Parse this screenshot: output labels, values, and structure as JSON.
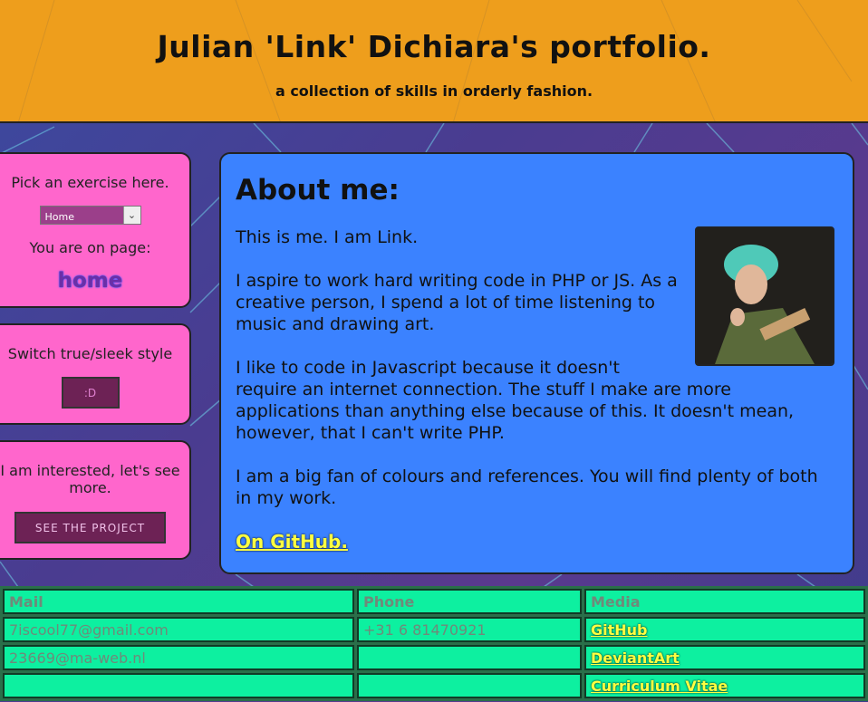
{
  "header": {
    "title": "Julian 'Link' Dichiara's portfolio.",
    "subtitle": "a collection of skills in orderly fashion."
  },
  "sidebar": {
    "exercise_prompt": "Pick an exercise here.",
    "exercise_select_value": "Home",
    "page_label": "You are on page:",
    "page_name": "home",
    "style_prompt": "Switch true/sleek style",
    "style_button_label": ":D",
    "project_prompt": "I am interested, let's see more.",
    "project_button_label": "SEE THE PROJECT"
  },
  "main": {
    "title": "About me:",
    "paragraphs": [
      "This is me. I am Link.",
      "I aspire to work hard writing code in PHP or JS. As a creative person, I spend a lot of time listening to music and drawing art.",
      "I like to code in Javascript because it doesn't require an internet connection. The stuff I make are more applications than anything else because of this. It doesn't mean, however, that I can't write PHP.",
      "I am a big fan of colours and references. You will find plenty of both in my work."
    ],
    "github_link": "On GitHub."
  },
  "contact_table": {
    "headers": [
      "Mail",
      "Phone",
      "Media"
    ],
    "rows": [
      [
        "7iscool77@gmail.com",
        "+31 6 81470921",
        "GitHub"
      ],
      [
        "23669@ma-web.nl",
        "",
        "DeviantArt"
      ],
      [
        "",
        "",
        "Curriculum Vitae"
      ]
    ]
  },
  "colors": {
    "header_bg": "#ee9e1c",
    "panel_bg": "#ff66cc",
    "main_bg": "#3b82ff",
    "table_bg": "#0df0a0",
    "link": "#ffff40"
  }
}
